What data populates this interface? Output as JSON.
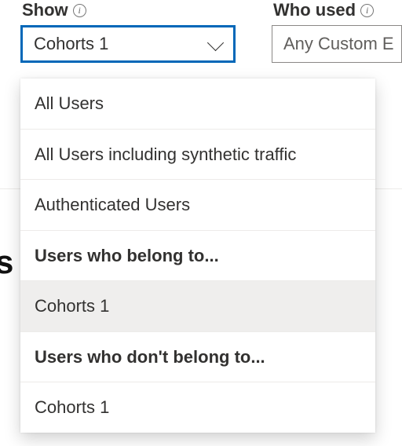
{
  "labels": {
    "show": "Show",
    "who_used": "Who used"
  },
  "show_select": {
    "value": "Cohorts 1"
  },
  "who_select": {
    "value": "Any Custom E"
  },
  "dropdown": {
    "items": [
      {
        "label": "All Users",
        "heading": false,
        "selected": false
      },
      {
        "label": "All Users including synthetic traffic",
        "heading": false,
        "selected": false
      },
      {
        "label": "Authenticated Users",
        "heading": false,
        "selected": false
      },
      {
        "label": "Users who belong to...",
        "heading": true,
        "selected": false
      },
      {
        "label": "Cohorts 1",
        "heading": false,
        "selected": true
      },
      {
        "label": "Users who don't belong to...",
        "heading": true,
        "selected": false
      },
      {
        "label": "Cohorts 1",
        "heading": false,
        "selected": false
      }
    ]
  },
  "behind": "s"
}
